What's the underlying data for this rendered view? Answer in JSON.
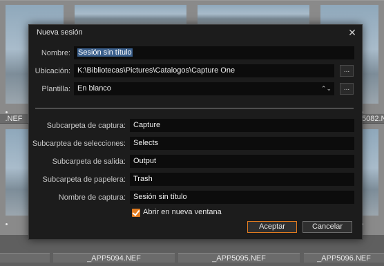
{
  "background": {
    "captions": [
      "_APP5094.NEF",
      "_APP5095.NEF",
      "_APP5096.NEF"
    ],
    "edge_captions": {
      "left": ".NEF",
      "right": "5082.N"
    }
  },
  "dialog": {
    "title": "Nueva sesión",
    "close_icon": "close-icon",
    "fields": {
      "nombre": {
        "label": "Nombre:",
        "value": "Sesión sin título"
      },
      "ubicacion": {
        "label": "Ubicación:",
        "value": "K:\\Bibliotecas\\Pictures\\Catalogos\\Capture One",
        "browse": "..."
      },
      "plantilla": {
        "label": "Plantilla:",
        "value": "En blanco",
        "browse": "...",
        "arrows": "⌃⌄"
      },
      "captura": {
        "label": "Subcarpeta de captura:",
        "value": "Capture"
      },
      "selecciones": {
        "label": "Subcarptea de selecciones:",
        "value": "Selects"
      },
      "salida": {
        "label": "Subcarpeta de salida:",
        "value": "Output"
      },
      "papelera": {
        "label": "Subcarpeta de papelera:",
        "value": "Trash"
      },
      "nombre_captura": {
        "label": "Nombre de captura:",
        "value": "Sesión sin título"
      }
    },
    "checkbox": {
      "label": "Abrir en nueva ventana",
      "checked": true
    },
    "buttons": {
      "accept": "Aceptar",
      "cancel": "Cancelar"
    },
    "colors": {
      "accent": "#e07a1f",
      "selection": "#3a5f8c"
    }
  }
}
